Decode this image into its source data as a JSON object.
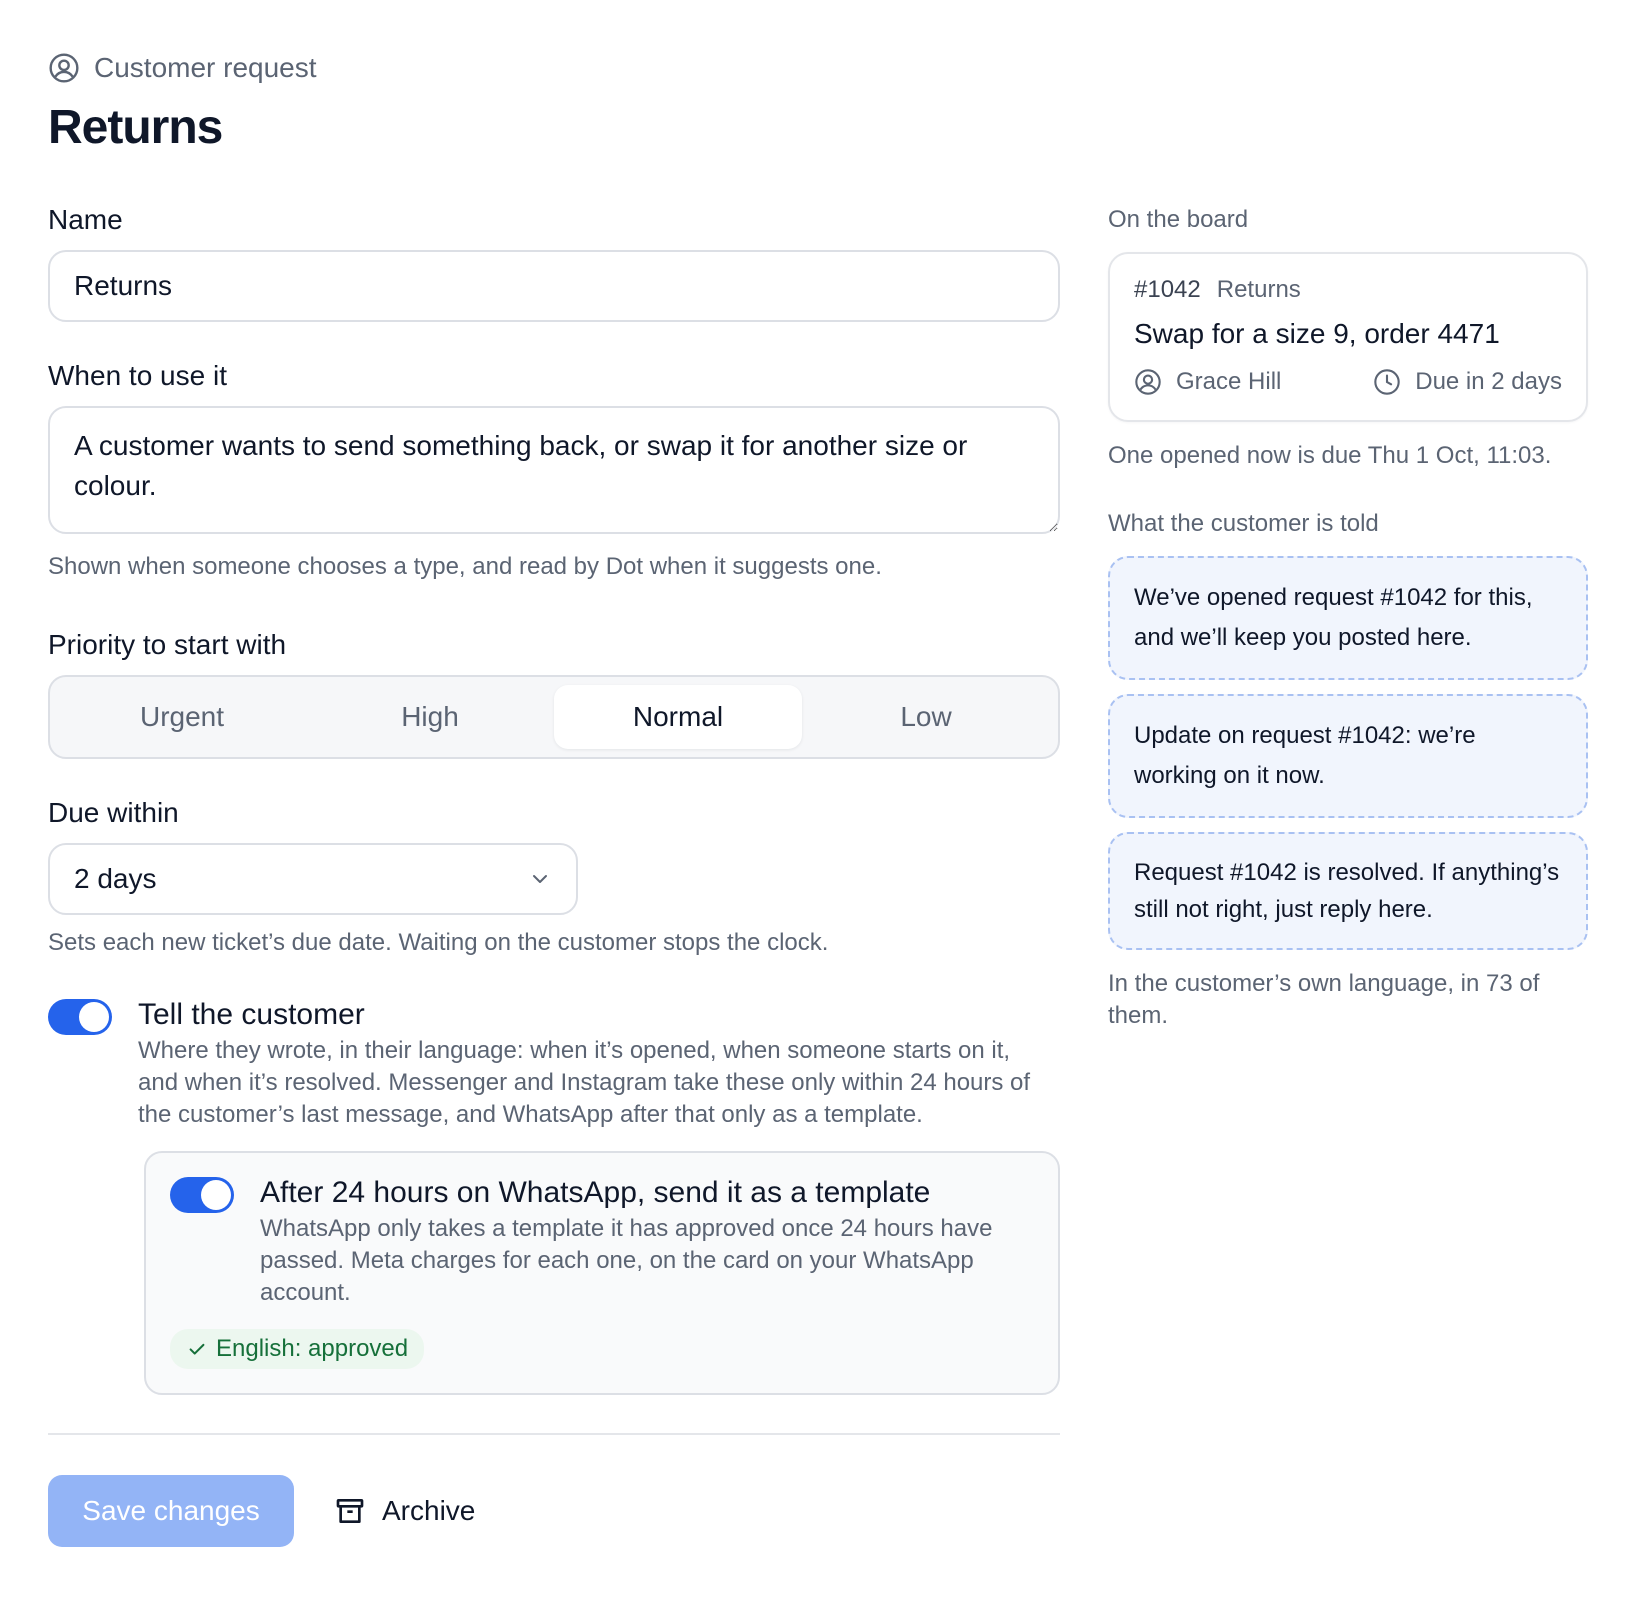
{
  "header": {
    "eyebrow": "Customer request",
    "eyebrow_icon": "user-circle-icon",
    "title": "Returns"
  },
  "form": {
    "name_label": "Name",
    "name_value": "Returns",
    "when_label": "When to use it",
    "when_value": "A customer wants to send something back, or swap it for another size or colour.",
    "when_help": "Shown when someone chooses a type, and read by Dot when it suggests one.",
    "priority_label": "Priority to start with",
    "priority_options": [
      "Urgent",
      "High",
      "Normal",
      "Low"
    ],
    "priority_selected": "Normal",
    "due_label": "Due within",
    "due_value": "2 days",
    "due_help": "Sets each new ticket’s due date. Waiting on the customer stops the clock.",
    "tell": {
      "enabled": true,
      "title": "Tell the customer",
      "description": "Where they wrote, in their language: when it’s opened, when someone starts on it, and when it’s resolved. Messenger and Instagram take these only within 24 hours of the customer’s last message, and WhatsApp after that only as a template."
    },
    "whatsapp": {
      "enabled": true,
      "title": "After 24 hours on WhatsApp, send it as a template",
      "description": "WhatsApp only takes a template it has approved once 24 hours have passed. Meta charges for each one, on the card on your WhatsApp account.",
      "badge": "English: approved"
    },
    "save_label": "Save changes",
    "archive_label": "Archive"
  },
  "sidebar": {
    "board_heading": "On the board",
    "card": {
      "id": "#1042",
      "type": "Returns",
      "title": "Swap for a size 9, order 4471",
      "assignee": "Grace Hill",
      "due": "Due in 2 days"
    },
    "board_note": "One opened now is due Thu 1 Oct, 11:03.",
    "told_heading": "What the customer is told",
    "messages": [
      "We’ve opened request #1042 for this, and we’ll keep you posted here.",
      "Update on request #1042: we’re working on it now.",
      "Request #1042 is resolved. If anything’s still not right, just reply here."
    ],
    "told_note": "In the customer’s own language, in 73 of them."
  },
  "colors": {
    "accent": "#2563eb",
    "save_disabled": "#93b4f6",
    "approved_bg": "#ecf7ef",
    "approved_text": "#16703a",
    "message_border": "#a9c1f2",
    "message_bg": "#f1f5fd"
  }
}
